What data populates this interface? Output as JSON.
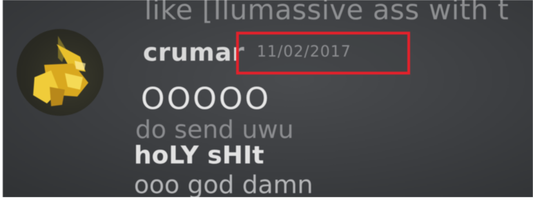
{
  "chat": {
    "previous_message": "like [Ilumassive ass with t",
    "author": "crumar",
    "date": "11/02/2017",
    "messages": [
      "OOOOO",
      "do send uwu",
      "hoLY sHIt",
      "ooo god damn"
    ]
  },
  "highlight": {
    "color": "#e3212b"
  },
  "avatar": {
    "icon": "gold-chick-avatar-icon"
  }
}
